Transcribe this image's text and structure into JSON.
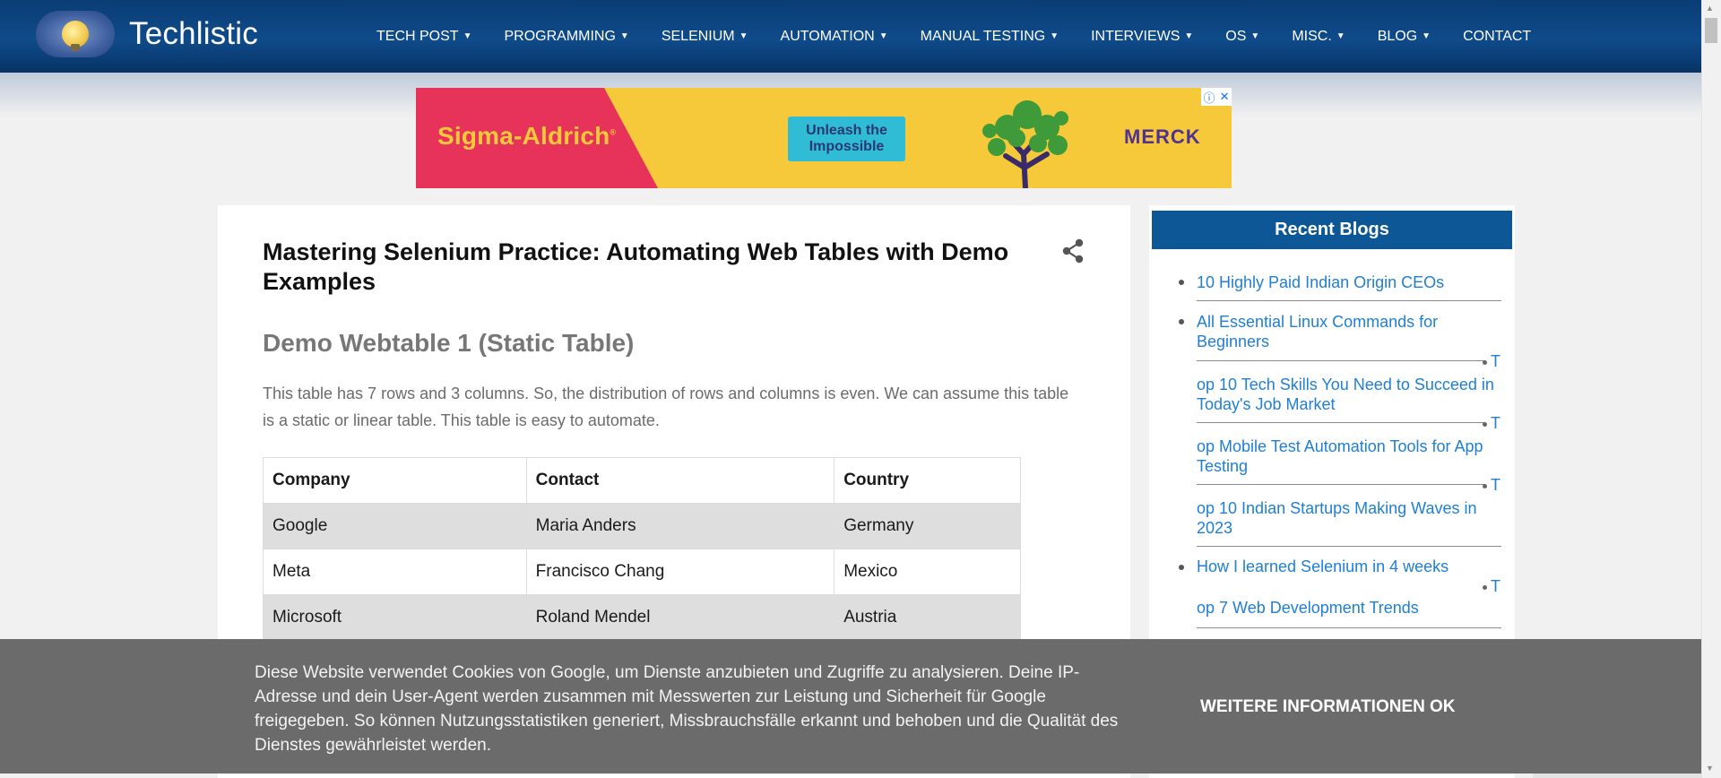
{
  "header": {
    "brand": "Techlistic",
    "nav": [
      {
        "label": "TECH POST",
        "caret": true
      },
      {
        "label": "PROGRAMMING",
        "caret": true
      },
      {
        "label": "SELENIUM",
        "caret": true
      },
      {
        "label": "AUTOMATION",
        "caret": true
      },
      {
        "label": "MANUAL TESTING",
        "caret": true
      },
      {
        "label": "INTERVIEWS",
        "caret": true
      },
      {
        "label": "OS",
        "caret": true
      },
      {
        "label": "MISC.",
        "caret": true
      },
      {
        "label": "BLOG",
        "caret": true
      },
      {
        "label": "CONTACT",
        "caret": false
      }
    ]
  },
  "ad": {
    "brand": "Sigma-Aldrich",
    "brand_mark": "®",
    "cta": "Unleash the Impossible",
    "logo": "MERCK",
    "info_icon": "ⓘ",
    "close_icon": "✕",
    "colors": {
      "red": "#e7325a",
      "yellow": "#f5c93a",
      "cyan": "#2fbcd4",
      "purple": "#503291"
    }
  },
  "post": {
    "title": "Mastering Selenium Practice: Automating Web Tables with Demo Examples",
    "section_title": "Demo Webtable 1 (Static Table)",
    "paragraph": "This table has 7 rows and 3 columns. So, the distribution of rows and columns is even. We can assume this table is a static or linear table. This table is easy to automate.",
    "table": {
      "headers": [
        "Company",
        "Contact",
        "Country"
      ],
      "rows": [
        [
          "Google",
          "Maria Anders",
          "Germany"
        ],
        [
          "Meta",
          "Francisco Chang",
          "Mexico"
        ],
        [
          "Microsoft",
          "Roland Mendel",
          "Austria"
        ]
      ]
    }
  },
  "sidebar": {
    "title": "Recent Blogs",
    "items": [
      {
        "text": "10 Highly Paid Indian Origin CEOs"
      },
      {
        "text": "All Essential Linux Commands for Beginners"
      },
      {
        "text": "op 10 Tech Skills You Need to Succeed in Today's Job Market"
      },
      {
        "text": "op Mobile Test Automation Tools for App Testing"
      },
      {
        "text": "op 10 Indian Startups Making Waves in 2023"
      },
      {
        "text": "How I learned Selenium in 4 weeks"
      },
      {
        "text": "op 7 Web Development Trends"
      }
    ],
    "fragment": "T"
  },
  "cookie": {
    "text": "Diese Website verwendet Cookies von Google, um Dienste anzubieten und Zugriffe zu analysieren. Deine IP-Adresse und dein User-Agent werden zusammen mit Messwerten zur Leistung und Sicherheit für Google freigegeben. So können Nutzungsstatistiken generiert, Missbrauchsfälle erkannt und behoben und die Qualität des Dienstes gewährleistet werden.",
    "more_label": "WEITERE INFORMATIONEN",
    "ok_label": "OK"
  },
  "colors": {
    "header_blue": "#0f4b8a",
    "sidebar_header": "#0e5796",
    "link_blue": "#1f7fd4",
    "cookie_bg": "#6b6b6b"
  }
}
